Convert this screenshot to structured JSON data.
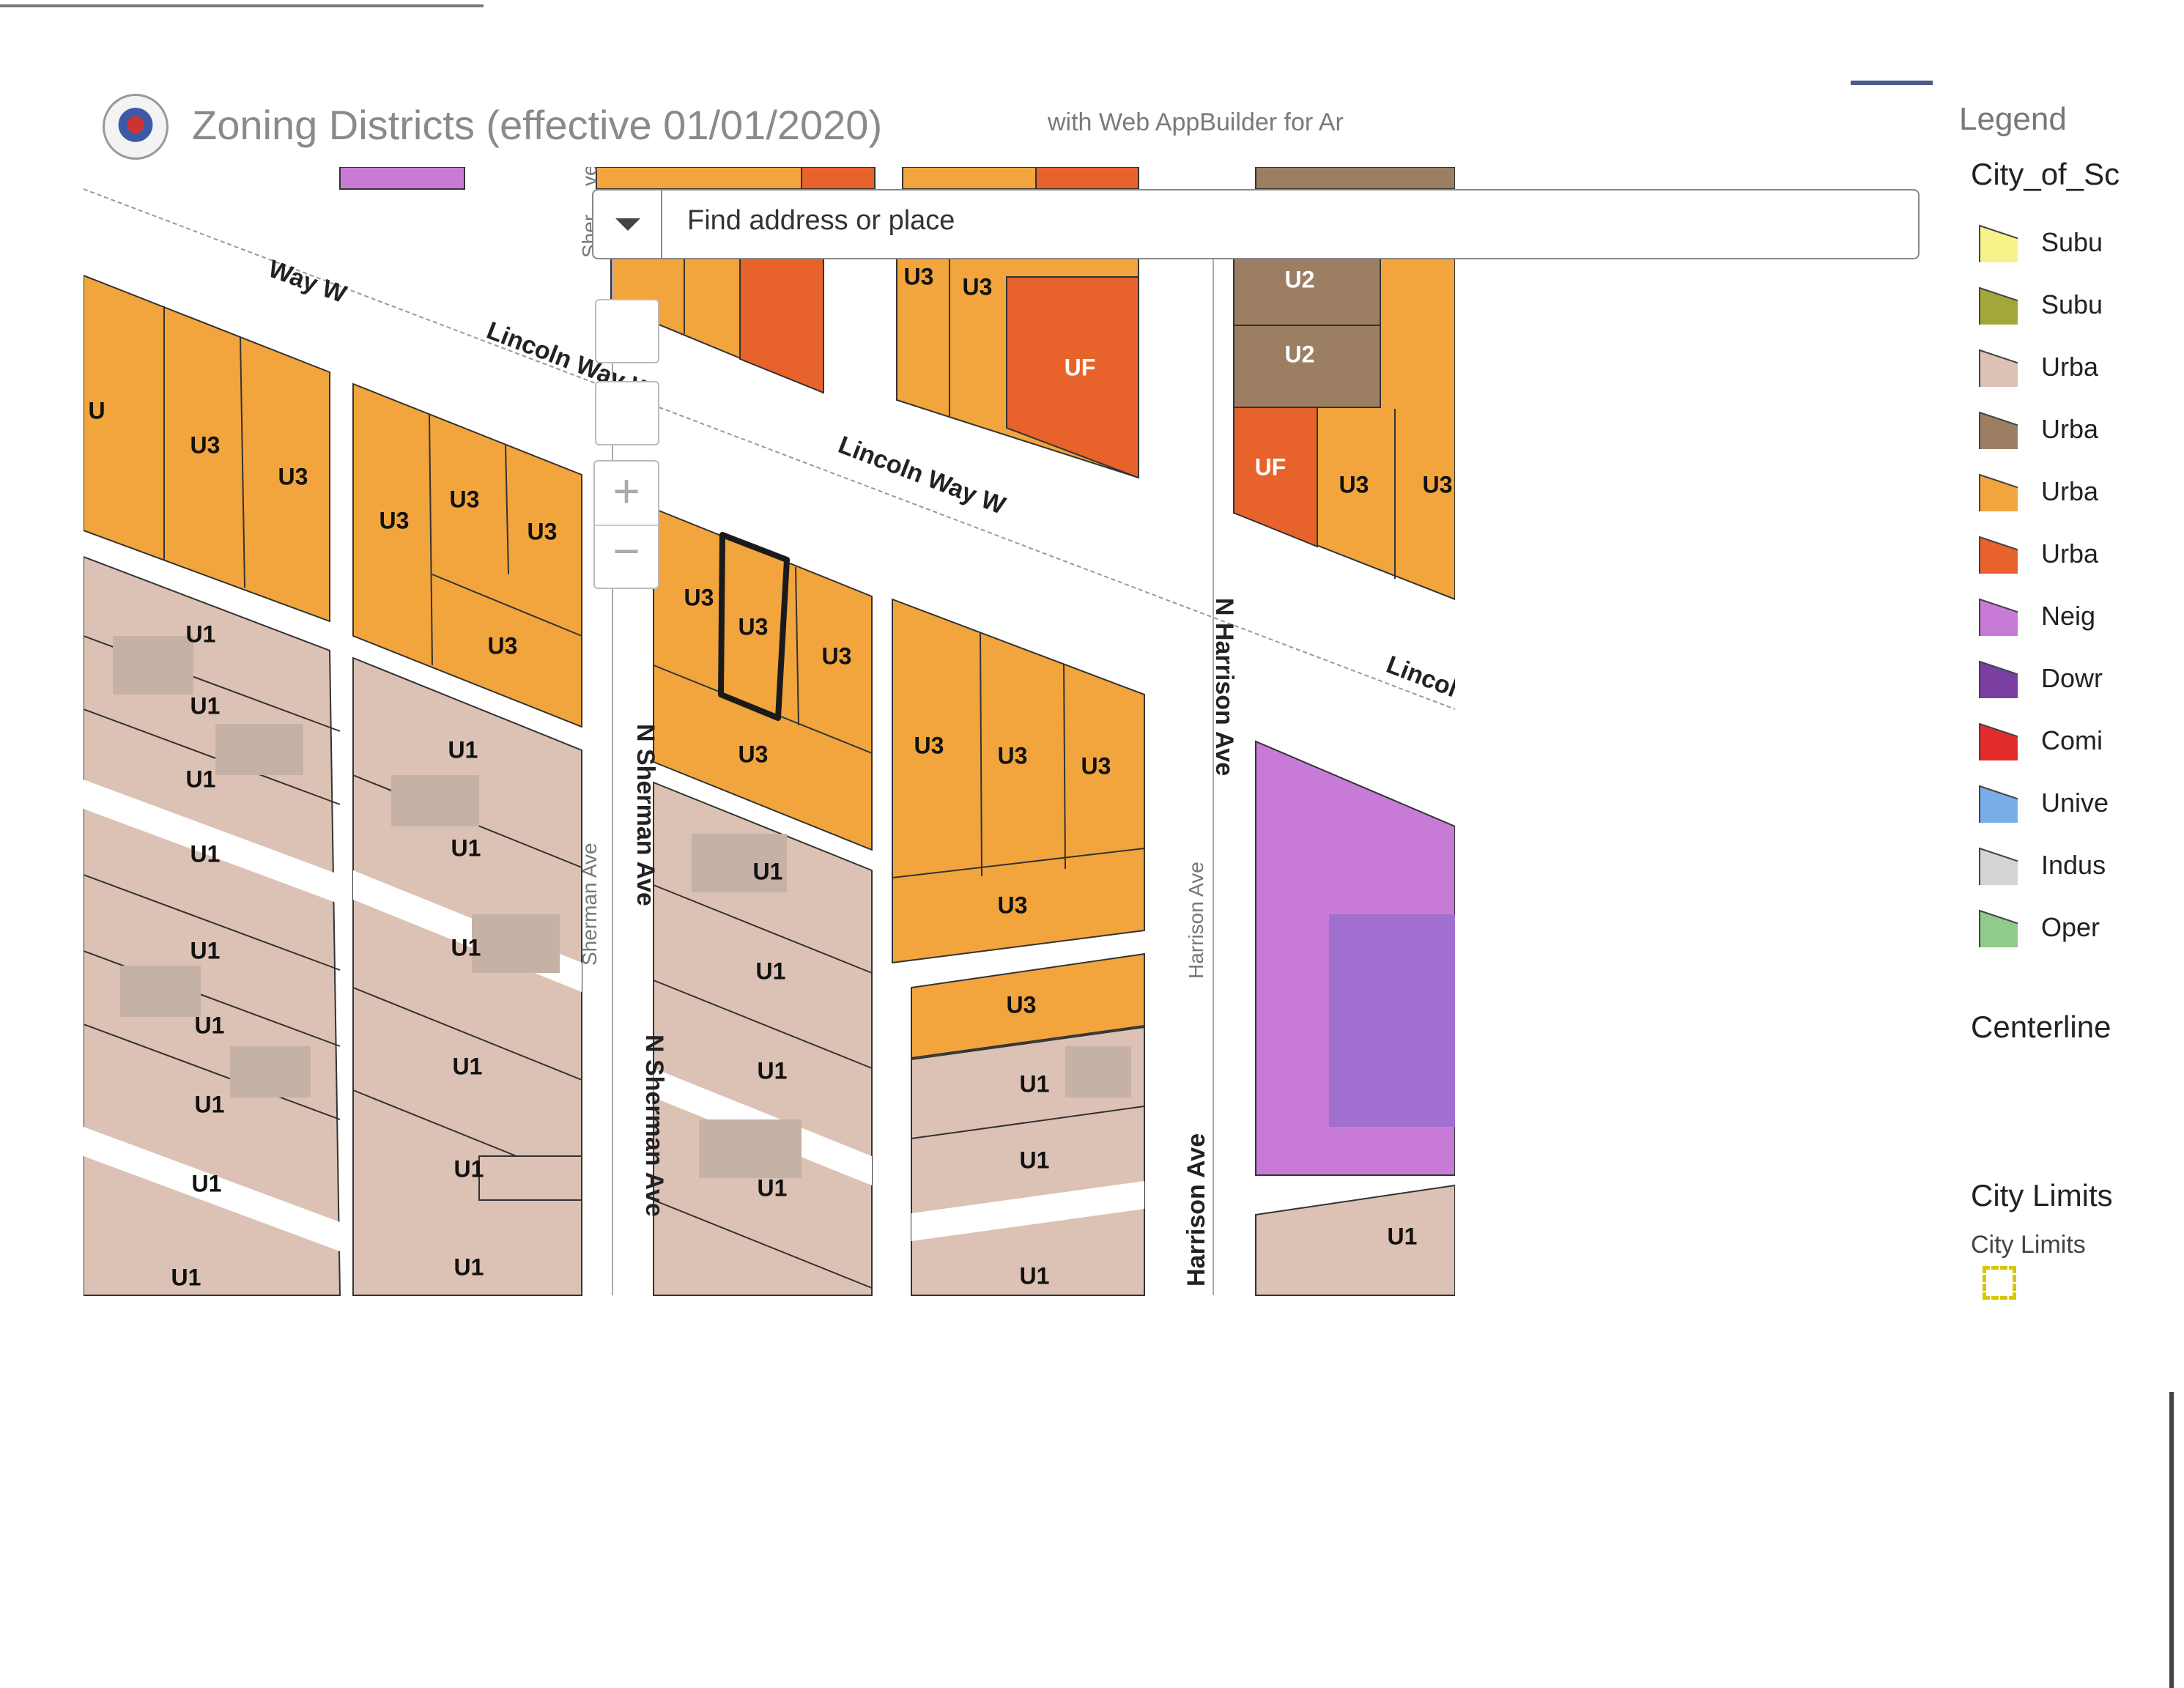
{
  "header": {
    "title": "Zoning Districts (effective 01/01/2020)",
    "subtitle": "with Web AppBuilder for Ar"
  },
  "search": {
    "placeholder": "Find address or place"
  },
  "map_controls": {
    "zoom_in": "+",
    "zoom_out": "−"
  },
  "colors": {
    "U1": "#dcc2b4",
    "U2": "#9c7f63",
    "U3": "#f2a53c",
    "UF": "#e8622b",
    "neighborhood": "#c87bd6",
    "downtown": "#7a3fa0",
    "street": "#ffffff",
    "building": "#b9a69e",
    "highlight_outline": "#1a1a1a"
  },
  "map": {
    "streets": {
      "lincoln_way_1": "Way W",
      "lincoln_way_2": "Lincoln Way W",
      "lincoln_way_3": "Lincoln Way W",
      "lincoln_way_4": "Lincol",
      "n_sherman_1": "N Sherman Ave",
      "n_sherman_2": "N Sherman Ave",
      "sherman_thin": "Sherman Ave",
      "sherman_top": "Sher",
      "n_harrison": "N Harrison Ave",
      "harrison_thin": "Harrison Ave",
      "harrison_bottom": "Harrison Ave",
      "top_ve": "ve"
    },
    "labels": {
      "U1": "U1",
      "U2": "U2",
      "U3": "U3",
      "UF": "UF",
      "U_partial": "U"
    }
  },
  "legend": {
    "title": "Legend",
    "layer": "City_of_Sc",
    "items": [
      {
        "label": "Subu",
        "color": "#f7f38a"
      },
      {
        "label": "Subu",
        "color": "#a3a73a"
      },
      {
        "label": "Urba",
        "color": "#dcc2b4"
      },
      {
        "label": "Urba",
        "color": "#9c7f63"
      },
      {
        "label": "Urba",
        "color": "#f2a53c"
      },
      {
        "label": "Urba",
        "color": "#e8622b"
      },
      {
        "label": "Neig",
        "color": "#c87bd6"
      },
      {
        "label": "Dowr",
        "color": "#7a3fa0"
      },
      {
        "label": "Comi",
        "color": "#e22c2c"
      },
      {
        "label": "Unive",
        "color": "#7aaee8"
      },
      {
        "label": "Indus",
        "color": "#d4d4d4"
      },
      {
        "label": "Oper",
        "color": "#8fcb8a"
      }
    ],
    "centerline": "Centerline",
    "city_limits": "City Limits",
    "city_limits_sub": "City Limits"
  }
}
